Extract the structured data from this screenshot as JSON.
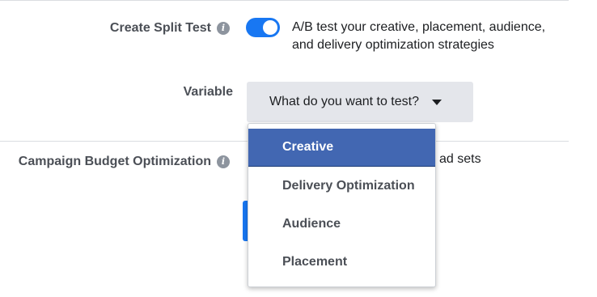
{
  "split_test": {
    "label": "Create Split Test",
    "info_icon": "info-icon",
    "toggle_on": true,
    "description": "A/B test your creative, placement, audience, and delivery optimization strategies"
  },
  "variable": {
    "label": "Variable",
    "select_text": "What do you want to test?",
    "options": [
      "Creative",
      "Delivery Optimization",
      "Audience",
      "Placement"
    ],
    "highlighted_option": "Creative"
  },
  "budget": {
    "label": "Campaign Budget Optimization",
    "info_icon": "info-icon",
    "partial_text": "ad sets"
  },
  "colors": {
    "accent": "#1877f2",
    "highlight": "#4267b2",
    "select_bg": "#e4e6eb"
  }
}
